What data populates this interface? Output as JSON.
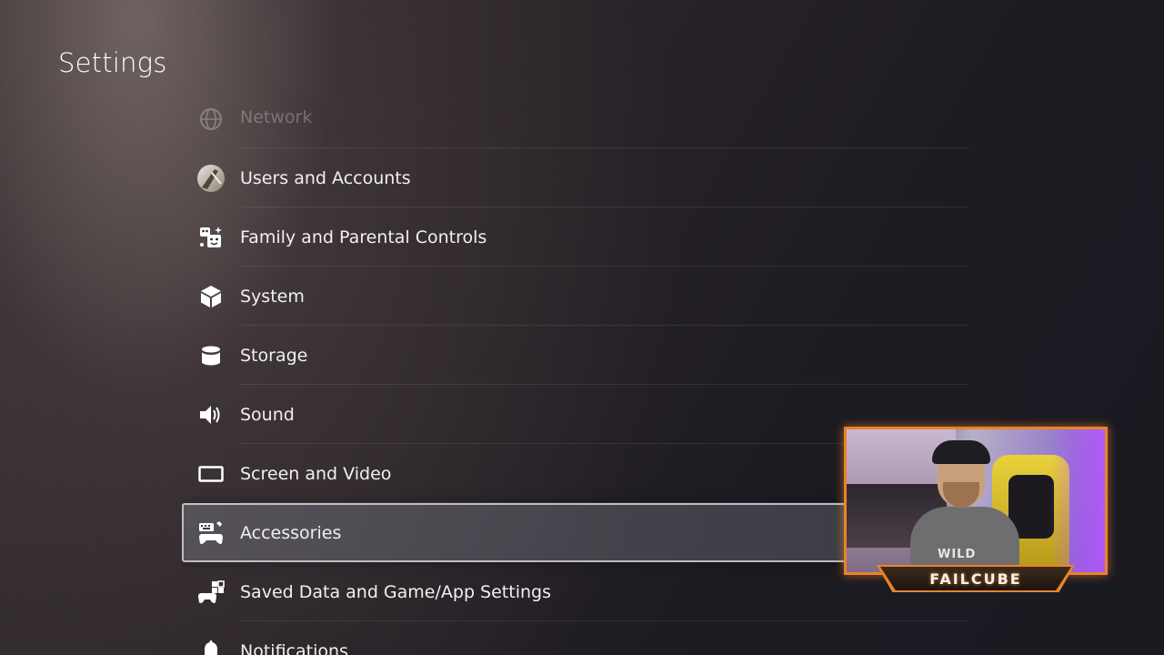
{
  "page": {
    "title": "Settings"
  },
  "menu": {
    "items": [
      {
        "label": "Network",
        "icon": "globe-icon"
      },
      {
        "label": "Users and Accounts",
        "icon": "avatar-icon"
      },
      {
        "label": "Family and Parental Controls",
        "icon": "family-icon"
      },
      {
        "label": "System",
        "icon": "cube-icon"
      },
      {
        "label": "Storage",
        "icon": "storage-icon"
      },
      {
        "label": "Sound",
        "icon": "speaker-icon"
      },
      {
        "label": "Screen and Video",
        "icon": "screen-icon"
      },
      {
        "label": "Accessories",
        "icon": "accessories-icon"
      },
      {
        "label": "Saved Data and Game/App Settings",
        "icon": "saved-data-icon"
      },
      {
        "label": "Notifications",
        "icon": "bell-icon"
      }
    ],
    "selected": "Accessories"
  },
  "webcam": {
    "streamer_name": "FAILCUBE",
    "shirt_text": "WILD",
    "accent_color": "#e8842a"
  }
}
